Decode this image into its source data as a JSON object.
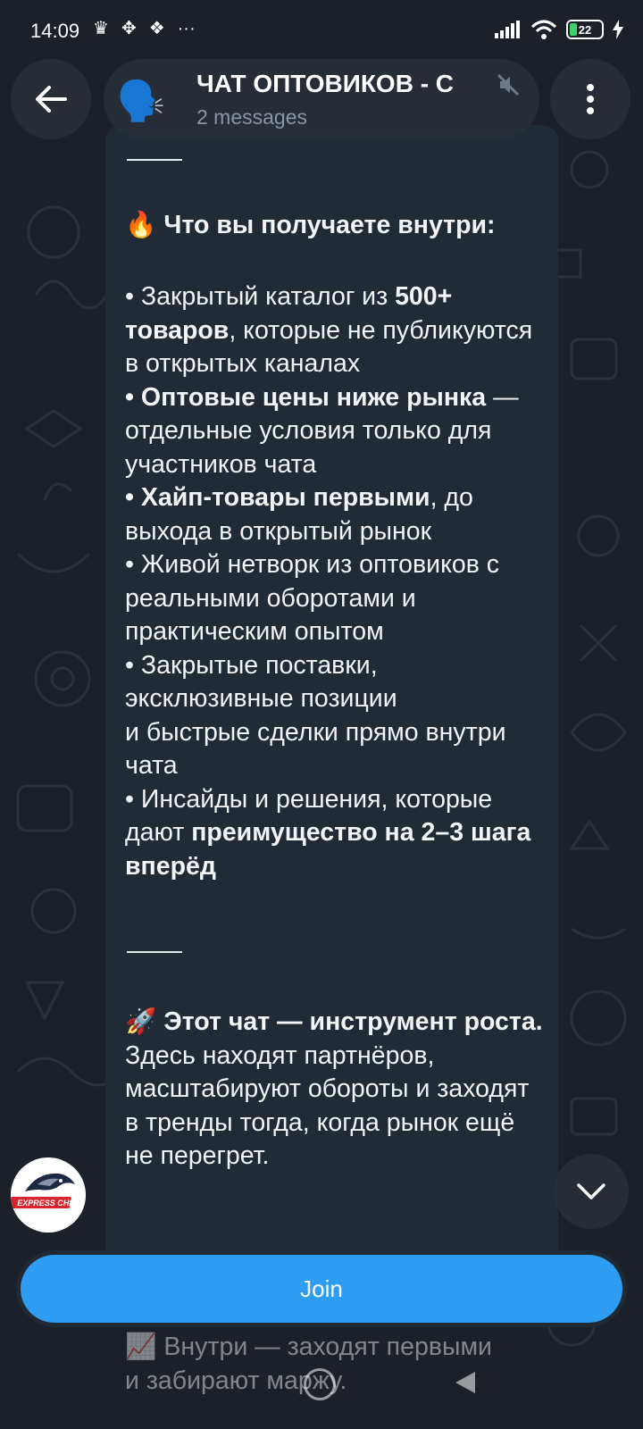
{
  "status_bar": {
    "time": "14:09",
    "left_icons": [
      "crown-icon",
      "move-icon",
      "binance-icon",
      "more-dots-icon"
    ],
    "left_glyphs": [
      "♛",
      "✥",
      "❖",
      "···"
    ],
    "battery_level": "22"
  },
  "header": {
    "avatar_emoji": "🗣️",
    "title": "ЧАТ ОПТОВИКОВ - С",
    "subtitle": "2 messages"
  },
  "message": {
    "separator_1": "——",
    "section1_emoji": "🔥",
    "section1_title": "Что вы получаете внутри:",
    "item1_pre": "• Закрытый каталог из ",
    "item1_bold": "500+ товаров",
    "item1_post": ", которые не публикуются в открытых каналах",
    "item2_bold": "• Оптовые цены ниже рынка",
    "item2_post": " — отдельные условия только для участников чата",
    "item3_bold": "• Хайп-товары первыми",
    "item3_post": ", до выхода в открытый рынок",
    "item4": "• Живой нетворк из оптовиков с реальными оборотами и практическим опытом",
    "item5": "• Закрытые поставки, эксклюзивные позиции",
    "item5b": "и быстрые сделки прямо внутри чата",
    "item6_pre": "• Инсайды и решения, которые дают ",
    "item6_bold": "преимущество на 2–3 шага вперёд",
    "separator_2": "——",
    "section2_emoji": "🚀",
    "section2_title": "Этот чат — инструмент роста.",
    "section2_text": "Здесь находят партнёров, масштабируют обороты и заходят в тренды тогда, когда рынок ещё не перегрет."
  },
  "behind_join": {
    "emoji": "📈",
    "line1": "Внутри — заходят первыми",
    "line2": "и забирают маржу."
  },
  "sender": {
    "logo_text": "EXPRESS CHINA"
  },
  "join_label": "Join",
  "colors": {
    "background": "#1c2129",
    "bubble": "#212b36",
    "accent": "#2e9cf0",
    "muted_text": "#8b95a3"
  }
}
